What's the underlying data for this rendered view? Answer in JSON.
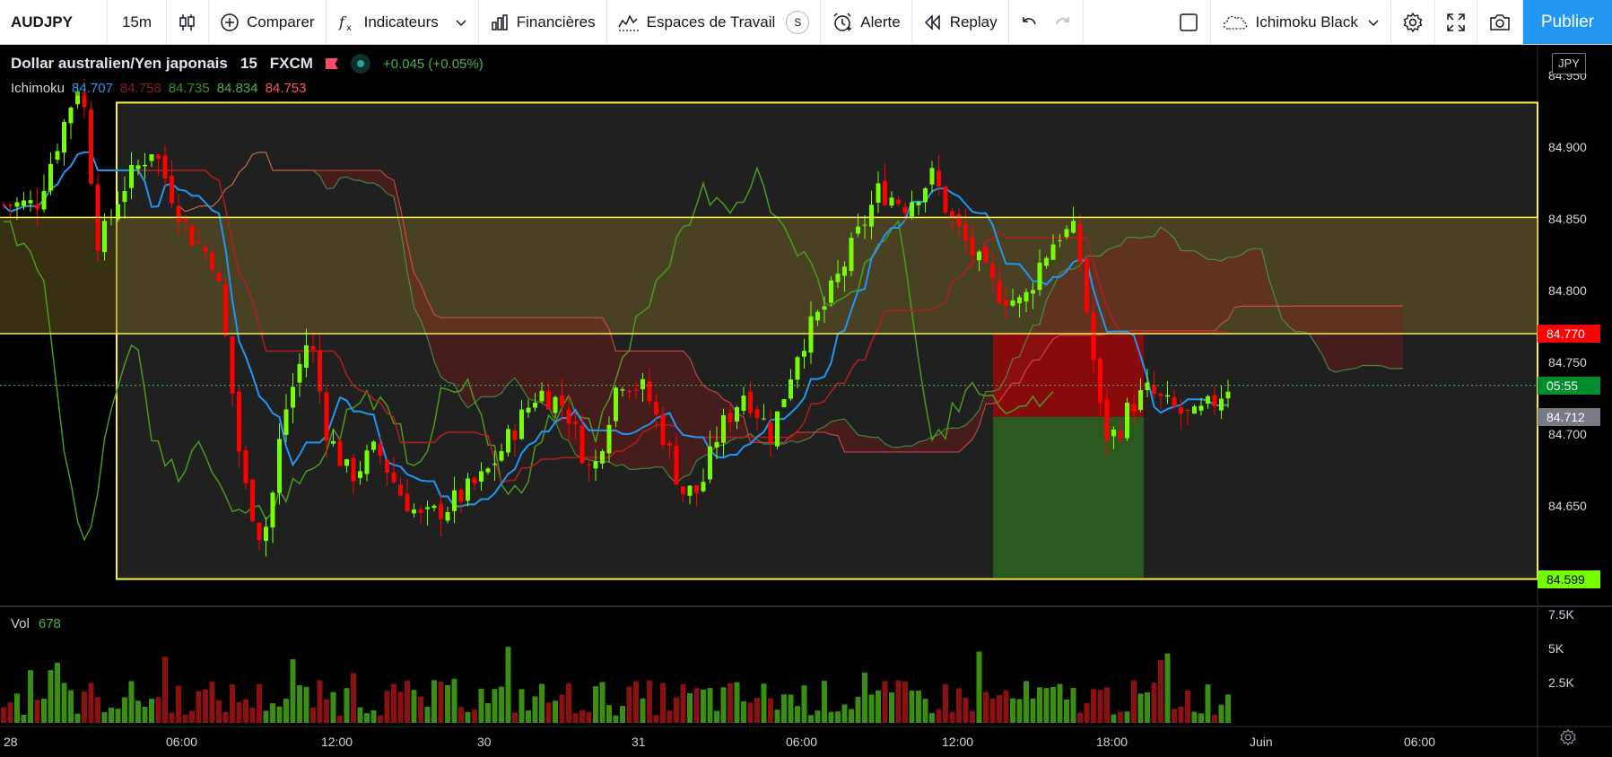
{
  "toolbar": {
    "symbol": "AUDJPY",
    "interval": "15m",
    "compare_label": "Comparer",
    "indicators_label": "Indicateurs",
    "financials_label": "Financières",
    "workspaces_label": "Espaces de Travail",
    "workspaces_badge": "S",
    "alert_label": "Alerte",
    "replay_label": "Replay",
    "layout_name": "Ichimoku Black",
    "publish_label": "Publier"
  },
  "legend": {
    "title": "Dollar australien/Yen japonais",
    "interval": "15",
    "source": "FXCM",
    "change": "+0.045 (+0.05%)",
    "ichimoku_label": "Ichimoku",
    "ichimoku_values": [
      {
        "value": "84.707",
        "color": "#2196f3"
      },
      {
        "value": "84.758",
        "color": "#8b1a1a"
      },
      {
        "value": "84.735",
        "color": "#3e8e1f"
      },
      {
        "value": "84.834",
        "color": "#4caf50"
      },
      {
        "value": "84.753",
        "color": "#ff5252"
      }
    ],
    "vol_label": "Vol",
    "vol_value": "678"
  },
  "currency_badge": "JPY",
  "chart_data": {
    "type": "candlestick",
    "y_axis": {
      "range": [
        84.62,
        84.94
      ],
      "ticks": [
        "84.950",
        "84.900",
        "84.850",
        "84.800",
        "84.750",
        "84.700",
        "84.650"
      ]
    },
    "volume_axis": {
      "ticks": [
        "7.5K",
        "5K",
        "2.5K"
      ]
    },
    "x_axis": {
      "ticks": [
        "28",
        "06:00",
        "12:00",
        "30",
        "31",
        "06:00",
        "12:00",
        "18:00",
        "Juin",
        "06:00"
      ]
    },
    "price_labels": [
      {
        "text": "84.770",
        "value": 84.77,
        "bg": "#ff0000",
        "fg": "#ffffff"
      },
      {
        "text": "05:55",
        "value": 84.734,
        "bg": "#008c2c",
        "fg": "#ffffff"
      },
      {
        "text": "84.712",
        "value": 84.712,
        "bg": "#787b86",
        "fg": "#ffffff"
      },
      {
        "text": "84.599",
        "value": 84.599,
        "bg": "#76ff03",
        "fg": "#000000"
      }
    ],
    "horizontal_lines": [
      84.931,
      84.851,
      84.77,
      84.599
    ],
    "ichimoku_latest": {
      "tenkan": 84.707,
      "kijun": 84.758,
      "chikou": 84.735,
      "senkou_a": 84.834,
      "senkou_b": 84.753
    },
    "volume_latest": 678,
    "colors": {
      "up": "#76ff03",
      "down": "#ff0000",
      "tenkan": "#2196f3",
      "kijun": "#b71c1c",
      "chikou": "#4b9a1d",
      "lines": "#f9ef3d"
    }
  }
}
